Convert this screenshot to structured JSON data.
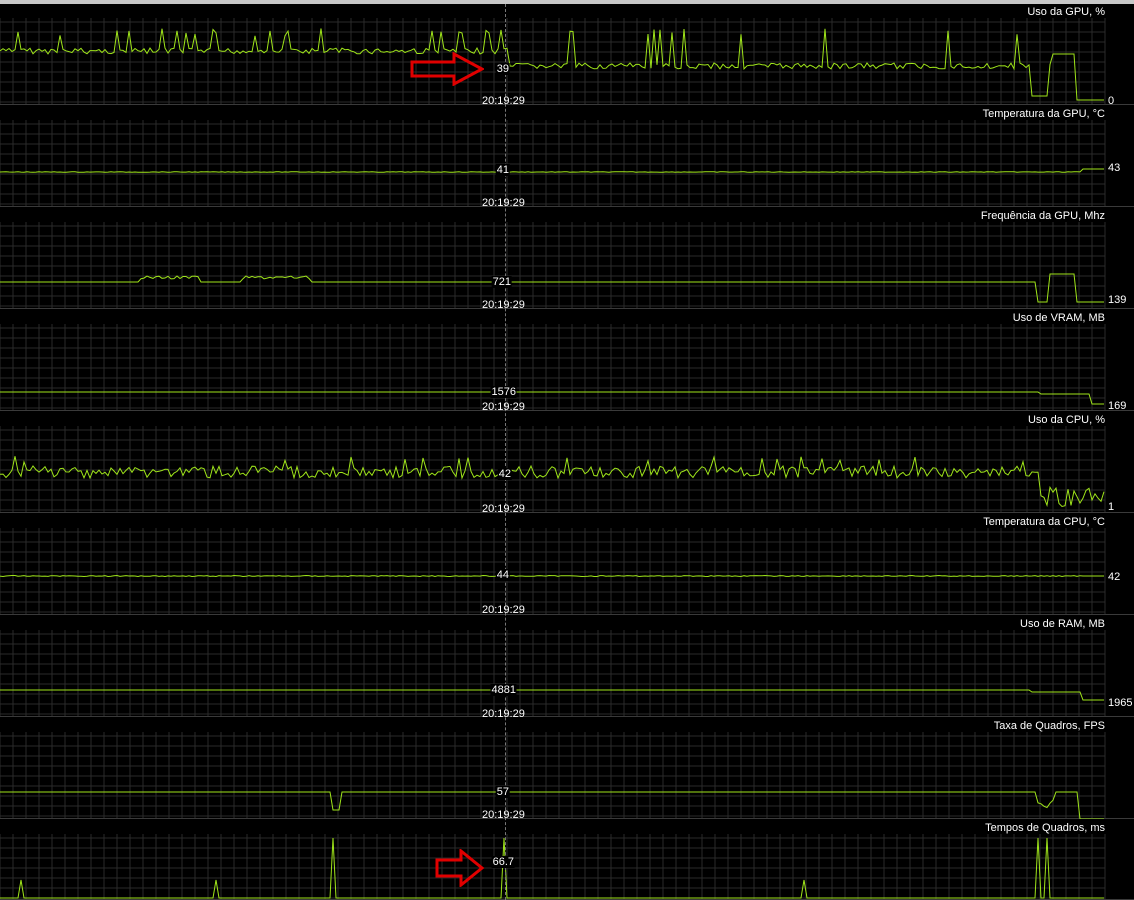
{
  "timestamp": "20:19:29",
  "colors": {
    "line": "#9fe51a",
    "grid": "#2a2a2a",
    "separator": "#3a3a3a",
    "arrow": "#e00000"
  },
  "panels": [
    {
      "id": "gpu-usage",
      "title": "Uso da GPU, %",
      "cursor_value": "39",
      "end_value": "0"
    },
    {
      "id": "gpu-temp",
      "title": "Temperatura da GPU, °C",
      "cursor_value": "41",
      "end_value": "43"
    },
    {
      "id": "gpu-freq",
      "title": "Frequência da GPU, Mhz",
      "cursor_value": "721",
      "end_value": "139"
    },
    {
      "id": "vram",
      "title": "Uso de VRAM, MB",
      "cursor_value": "1576",
      "end_value": "169"
    },
    {
      "id": "cpu-usage",
      "title": "Uso da CPU, %",
      "cursor_value": "42",
      "end_value": "1"
    },
    {
      "id": "cpu-temp",
      "title": "Temperatura da CPU, °C",
      "cursor_value": "44",
      "end_value": "42"
    },
    {
      "id": "ram",
      "title": "Uso de RAM, MB",
      "cursor_value": "4881",
      "end_value": "1965"
    },
    {
      "id": "fps",
      "title": "Taxa de Quadros, FPS",
      "cursor_value": "57",
      "end_value": ""
    },
    {
      "id": "frametime",
      "title": "Tempos de Quadros, ms",
      "cursor_value": "66.7",
      "end_value": ""
    }
  ],
  "annotations": [
    {
      "name": "red-arrow-gpu-usage",
      "points_to": "39"
    },
    {
      "name": "red-arrow-frametime",
      "points_to": "66.7"
    }
  ]
}
